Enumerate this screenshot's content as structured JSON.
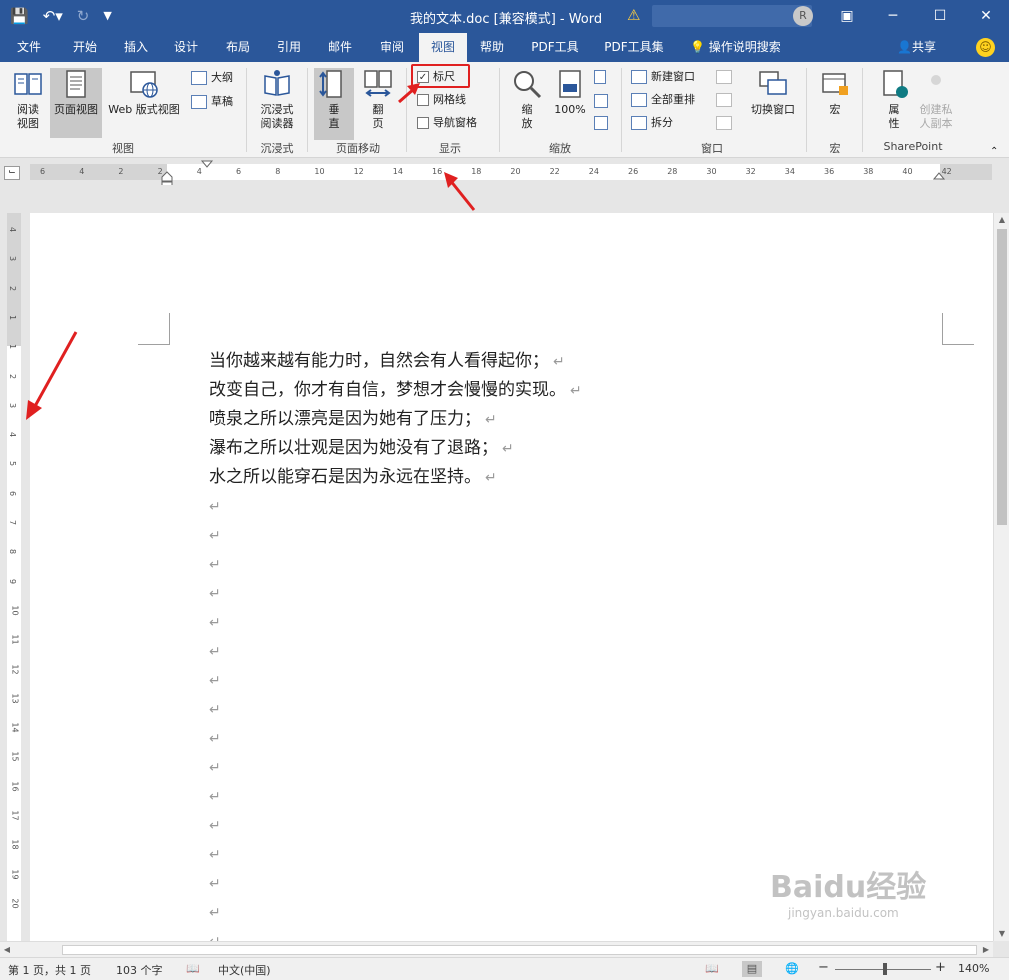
{
  "titlebar": {
    "title": "我的文本.doc [兼容模式]  -  Word",
    "qat": [
      "save-icon",
      "undo-icon",
      "redo-icon",
      "customize-icon"
    ],
    "win_buttons": [
      "▣",
      "─",
      "☐",
      "✕"
    ]
  },
  "tabs": [
    "文件",
    "开始",
    "插入",
    "设计",
    "布局",
    "引用",
    "邮件",
    "审阅",
    "视图",
    "帮助",
    "PDF工具",
    "PDF工具集"
  ],
  "active_tab": "视图",
  "tellme": "操作说明搜索",
  "share": "共享",
  "ribbon": {
    "views": {
      "read": "阅读\n视图",
      "print_layout": "页面视图",
      "web_layout": "Web 版式视图",
      "outline": "大纲",
      "draft": "草稿",
      "label": "视图"
    },
    "immersive": {
      "reader": "沉浸式\n阅读器",
      "label": "沉浸式"
    },
    "page_movement": {
      "vertical": "垂\n直",
      "side": "翻\n页",
      "label": "页面移动"
    },
    "show": {
      "ruler": "标尺",
      "gridlines": "网格线",
      "nav_pane": "导航窗格",
      "label": "显示",
      "ruler_checked": true,
      "gridlines_checked": false,
      "nav_checked": false
    },
    "zoom": {
      "zoom": "缩\n放",
      "percent": "100%",
      "label": "缩放"
    },
    "window": {
      "new_window": "新建窗口",
      "arrange_all": "全部重排",
      "split": "拆分",
      "switch": "切换窗口",
      "label": "窗口"
    },
    "macros": {
      "macros": "宏",
      "label": "宏"
    },
    "sharepoint": {
      "properties": "属\n性",
      "private_copy": "创建私\n人副本",
      "label": "SharePoint"
    }
  },
  "hruler_labels": [
    "6",
    "4",
    "2",
    "2",
    "4",
    "6",
    "8",
    "10",
    "12",
    "14",
    "16",
    "18",
    "20",
    "22",
    "24",
    "26",
    "28",
    "30",
    "32",
    "34",
    "36",
    "38",
    "40",
    "42"
  ],
  "vruler_labels": [
    "4",
    "3",
    "2",
    "1",
    "1",
    "2",
    "3",
    "4",
    "5",
    "6",
    "7",
    "8",
    "9",
    "10",
    "11",
    "12",
    "13",
    "14",
    "15",
    "16",
    "17",
    "18",
    "19",
    "20"
  ],
  "document": {
    "lines": [
      "当你越来越有能力时，自然会有人看得起你；",
      "改变自己，你才有自信，梦想才会慢慢的实现。",
      "喷泉之所以漂亮是因为她有了压力；",
      "瀑布之所以壮观是因为她没有了退路；",
      "水之所以能穿石是因为永远在坚持。"
    ],
    "paragraph_mark": "↵",
    "empty_paragraphs": 16
  },
  "status": {
    "page": "第 1 页，共 1 页",
    "words": "103 个字",
    "language": "中文(中国)",
    "zoom": "140%",
    "zoom_fraction": 0.52
  },
  "watermark": {
    "brand": "Baidu经验",
    "url": "jingyan.baidu.com"
  },
  "colors": {
    "accent": "#2b579a",
    "annotation": "#e02020"
  }
}
